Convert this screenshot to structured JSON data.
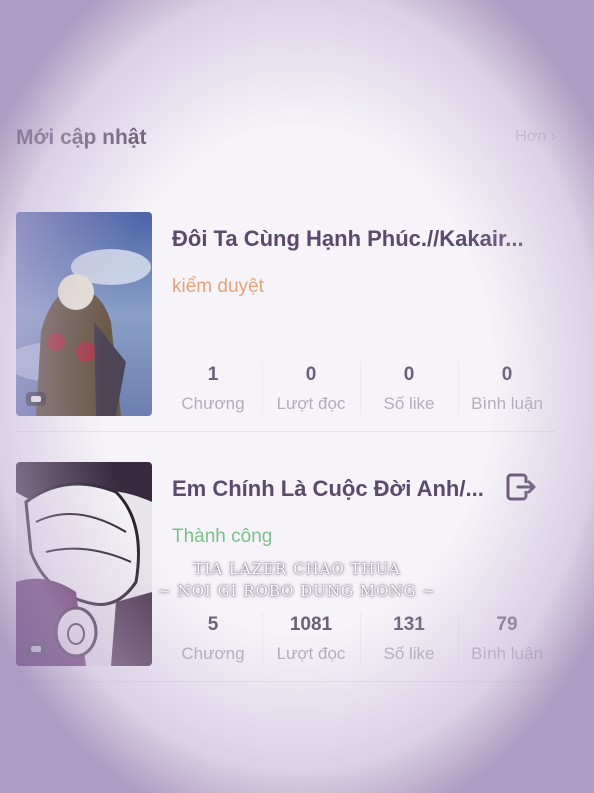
{
  "section": {
    "title": "Mới cập nhật",
    "more": "Hơn ›"
  },
  "stories": [
    {
      "title": "Đôi Ta Cùng Hạnh Phúc.//Kakair...",
      "status": "kiểm duyệt",
      "stats": [
        {
          "value": "1",
          "label": "Chương"
        },
        {
          "value": "0",
          "label": "Lượt đọc"
        },
        {
          "value": "0",
          "label": "Số like"
        },
        {
          "value": "0",
          "label": "Bình luận"
        }
      ]
    },
    {
      "title": "Em Chính Là Cuộc Đời Anh/...",
      "status": "Thành công",
      "stats": [
        {
          "value": "5",
          "label": "Chương"
        },
        {
          "value": "1081",
          "label": "Lượt đọc"
        },
        {
          "value": "131",
          "label": "Số like"
        },
        {
          "value": "79",
          "label": "Bình luận"
        }
      ]
    }
  ],
  "overlay": {
    "line1": "TIA LAZER CHAO THUA",
    "line2": "~ NOI GI ROBO DUNG MONG ~"
  },
  "colors": {
    "title": "#5b4a6b",
    "status_review": "#e0a37c",
    "status_ok": "#7dbf8b",
    "stat_label": "#b3acbb"
  },
  "icons": {
    "exit": "exit-icon",
    "chat_badge": "chat-icon"
  }
}
